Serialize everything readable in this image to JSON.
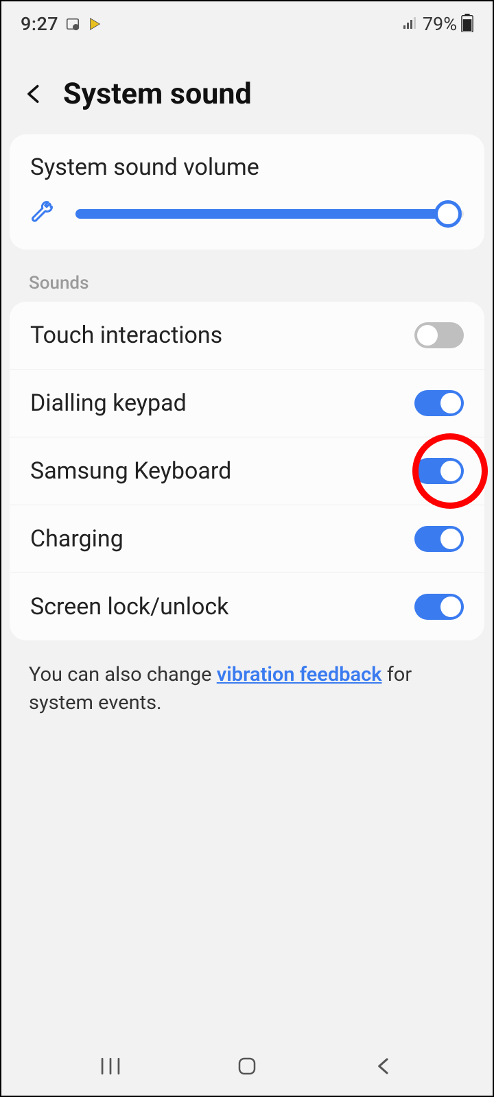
{
  "status": {
    "time": "9:27",
    "battery_pct": "79%"
  },
  "header": {
    "title": "System sound"
  },
  "volume": {
    "label": "System sound volume",
    "pct": 96
  },
  "sounds_label": "Sounds",
  "items": [
    {
      "label": "Touch interactions",
      "on": false,
      "highlight": false
    },
    {
      "label": "Dialling keypad",
      "on": true,
      "highlight": false
    },
    {
      "label": "Samsung Keyboard",
      "on": true,
      "highlight": true
    },
    {
      "label": "Charging",
      "on": true,
      "highlight": false
    },
    {
      "label": "Screen lock/unlock",
      "on": true,
      "highlight": false
    }
  ],
  "footer": {
    "prefix": "You can also change ",
    "link": "vibration feedback",
    "suffix": " for system events."
  }
}
